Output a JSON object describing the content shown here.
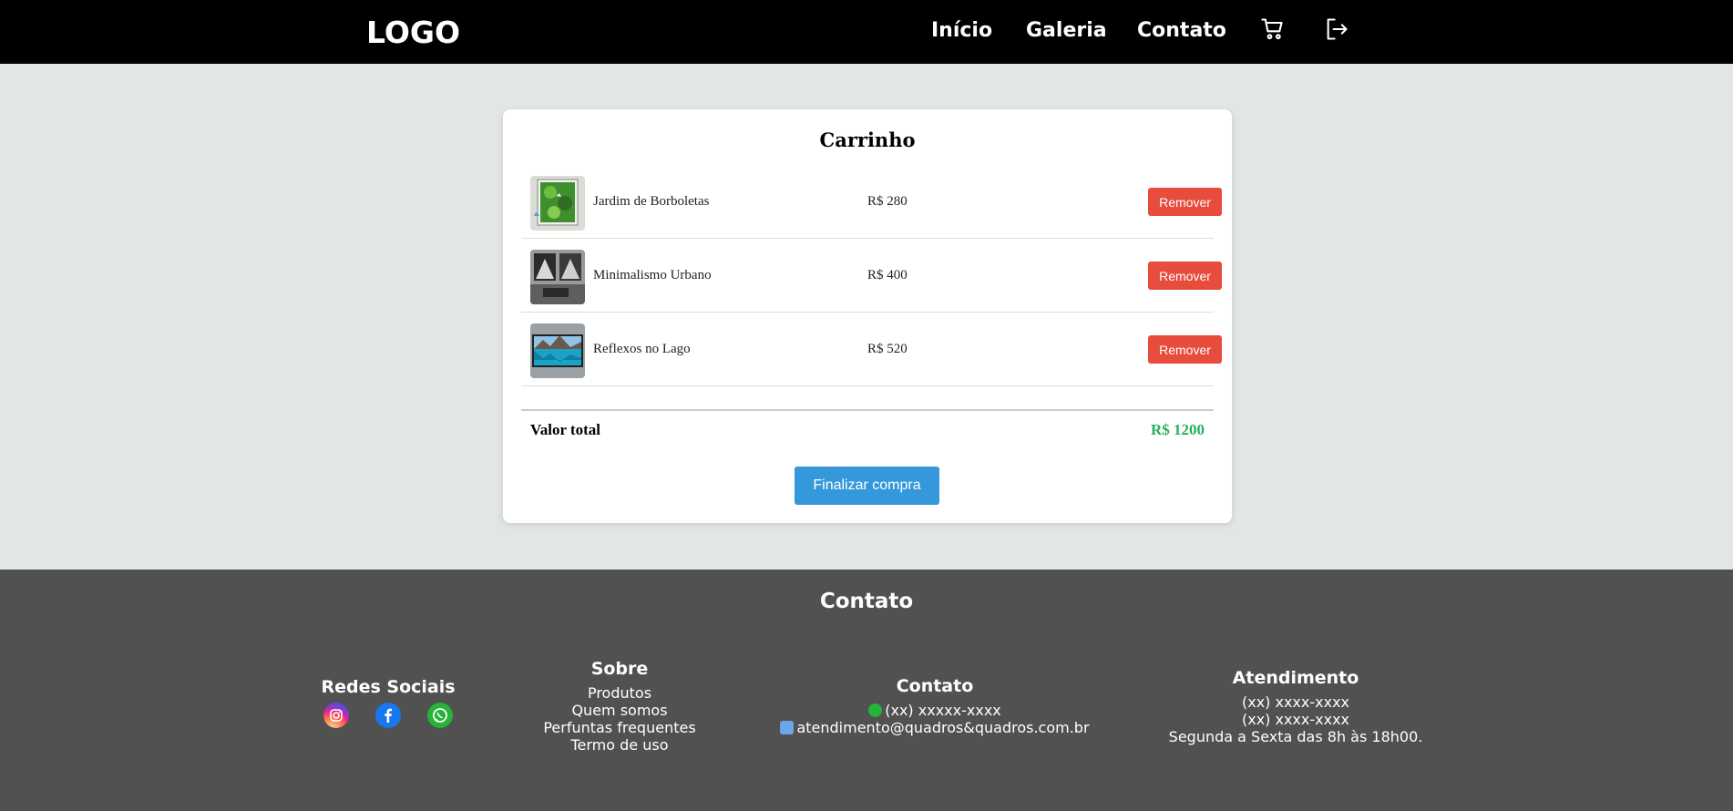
{
  "header": {
    "logo": "LOGO",
    "nav": [
      "Início",
      "Galeria",
      "Contato"
    ],
    "icons": [
      "cart-icon",
      "logout-icon"
    ]
  },
  "cart": {
    "title": "Carrinho",
    "items": [
      {
        "name": "Jardim de Borboletas",
        "price": "R$ 280",
        "remove_label": "Remover"
      },
      {
        "name": "Minimalismo Urbano",
        "price": "R$ 400",
        "remove_label": "Remover"
      },
      {
        "name": "Reflexos no Lago",
        "price": "R$ 520",
        "remove_label": "Remover"
      }
    ],
    "total_label": "Valor total",
    "total_value": "R$ 1200",
    "checkout_label": "Finalizar compra"
  },
  "footer": {
    "title": "Contato",
    "social": {
      "heading": "Redes Sociais",
      "icons": [
        "instagram-icon",
        "facebook-icon",
        "whatsapp-icon"
      ]
    },
    "about": {
      "heading": "Sobre",
      "links": [
        "Produtos",
        "Quem somos",
        "Perfuntas frequentes",
        "Termo de uso"
      ]
    },
    "contact": {
      "heading": "Contato",
      "phone": "(xx) xxxxx-xxxx",
      "email": "atendimento@quadros&quadros.com.br"
    },
    "service": {
      "heading": "Atendimento",
      "phone1": "(xx) xxxx-xxxx",
      "phone2": "(xx) xxxx-xxxx",
      "hours": "Segunda a Sexta das 8h às 18h00."
    }
  },
  "colors": {
    "header_bg": "#000000",
    "page_bg": "#e3e6e7",
    "remove_button": "#e74c3c",
    "checkout_button": "#3498db",
    "total_value": "#27ae60",
    "footer_bg": "#515151"
  }
}
